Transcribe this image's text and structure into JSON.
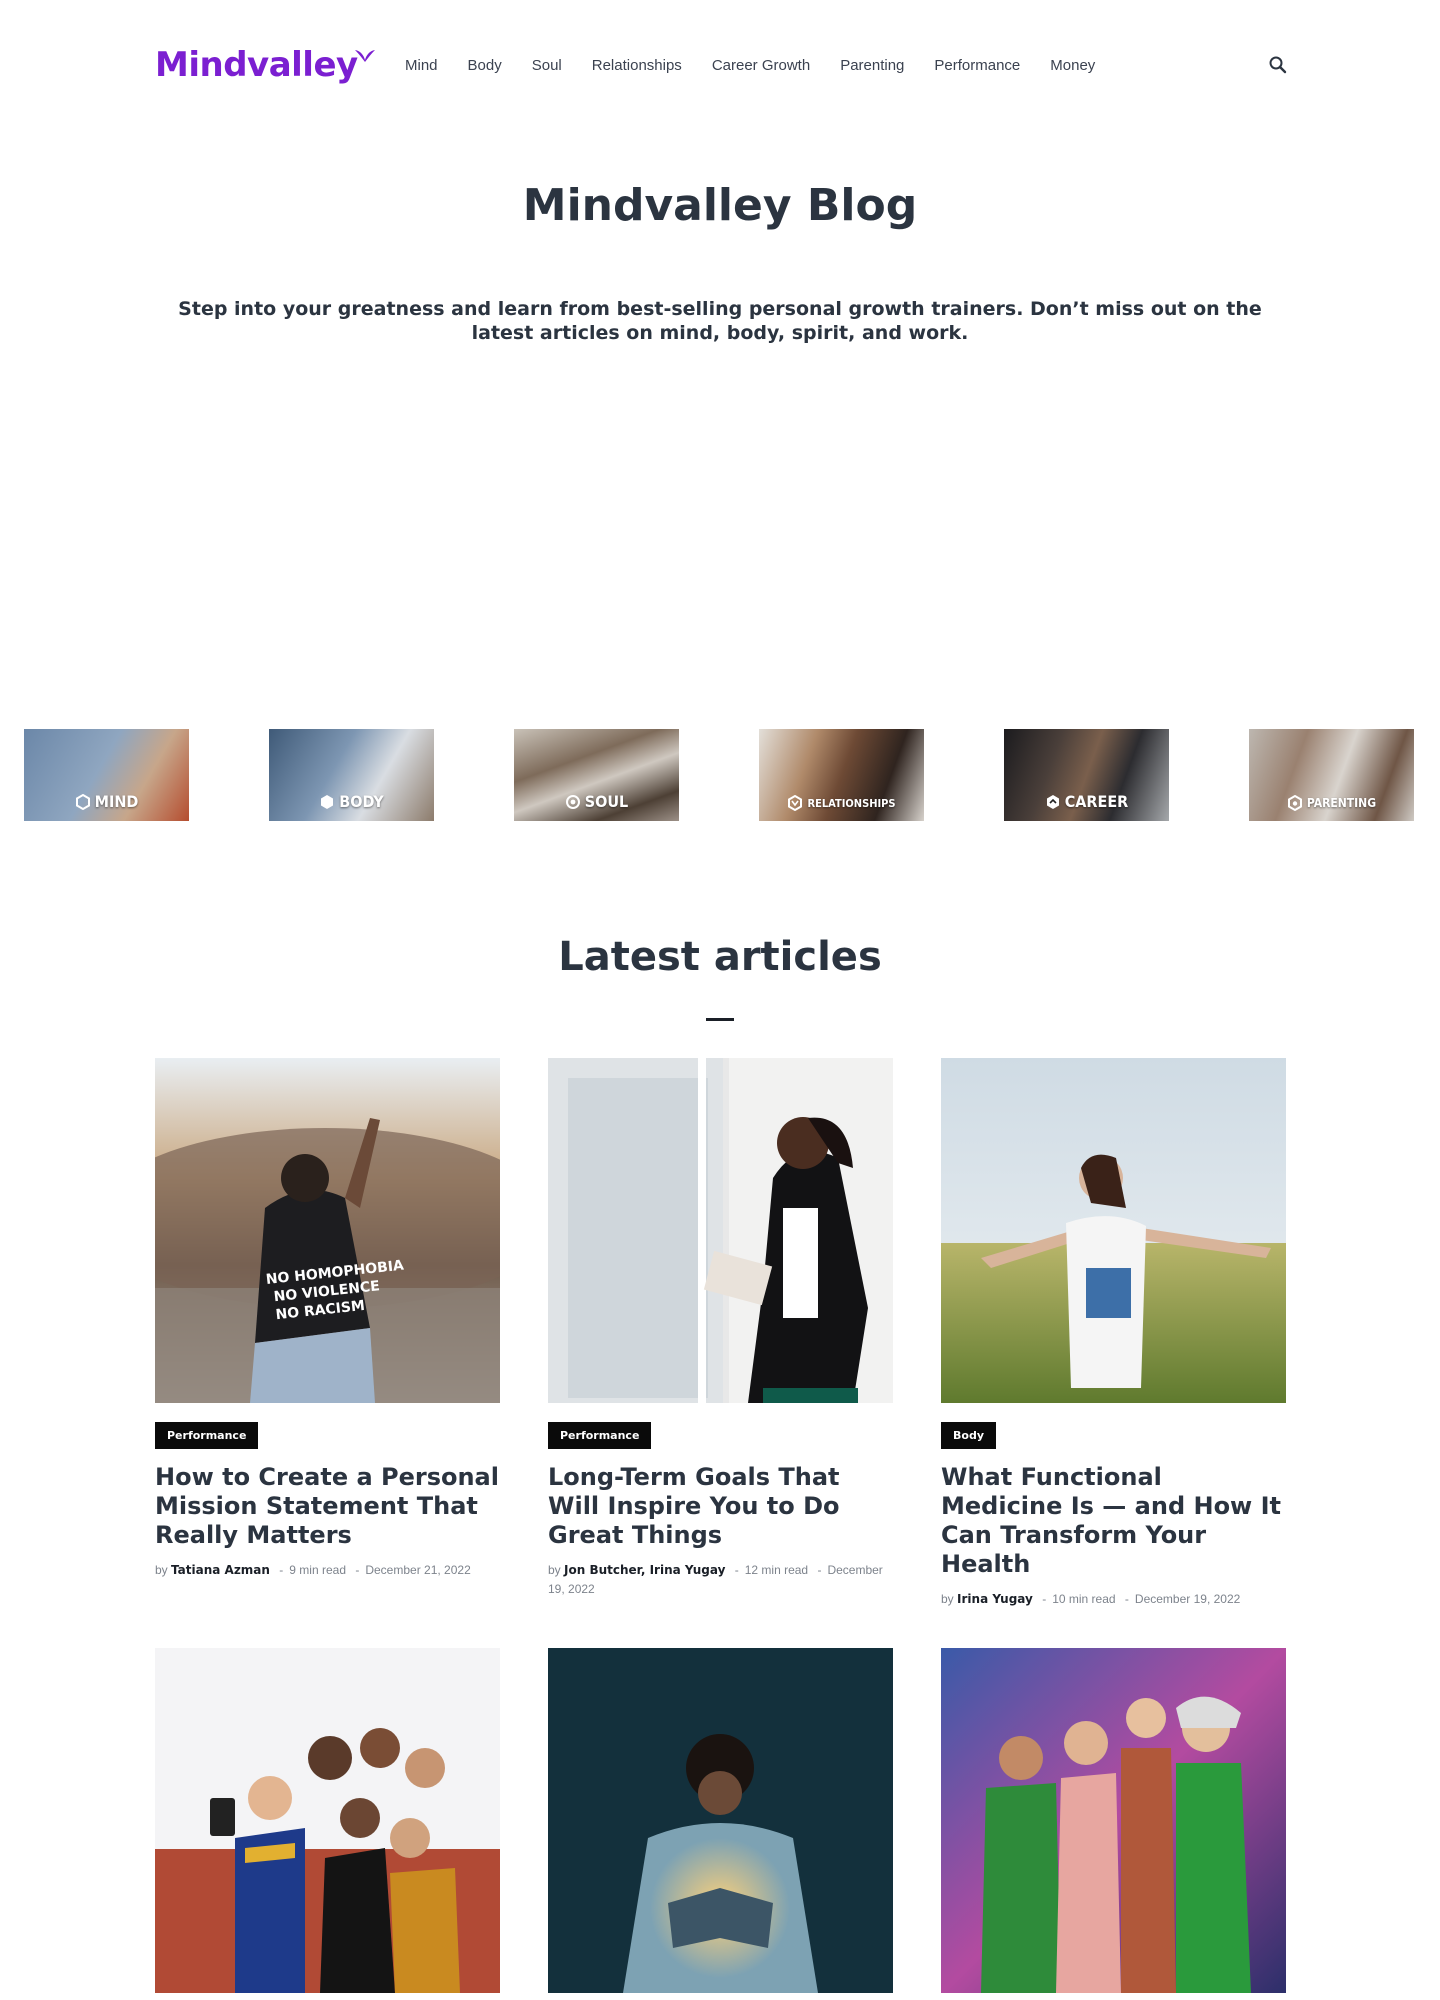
{
  "nav": {
    "logo": "Mindvalley",
    "items": [
      "Mind",
      "Body",
      "Soul",
      "Relationships",
      "Career Growth",
      "Parenting",
      "Performance",
      "Money"
    ],
    "search_icon": "search-icon",
    "brand_color": "#7b1fd1"
  },
  "hero": {
    "title": "Mindvalley Blog",
    "subtitle": "Step into your greatness and learn from best-selling personal growth trainers. Don’t miss out on the latest articles on mind, body, spirit, and work."
  },
  "categories": [
    {
      "label": "MIND",
      "icon": "mind-hex-icon"
    },
    {
      "label": "BODY",
      "icon": "body-hex-icon"
    },
    {
      "label": "SOUL",
      "icon": "soul-circle-icon"
    },
    {
      "label": "RELATIONSHIPS",
      "icon": "relationships-hex-icon"
    },
    {
      "label": "CAREER",
      "icon": "career-hex-icon"
    },
    {
      "label": "PARENTING",
      "icon": "parenting-hex-icon"
    }
  ],
  "latest": {
    "title": "Latest articles",
    "articles": [
      {
        "category": "Performance",
        "title": "How to Create a Personal Mission Statement That Really Matters",
        "by": "by",
        "authors": "Tatiana Azman",
        "read": "9 min read",
        "date": "December 21, 2022",
        "image": "woman-with-shirt-at-bean-photo"
      },
      {
        "category": "Performance",
        "title": "Long-Term Goals That Will Inspire You to Do Great Things",
        "by": "by",
        "authors": "Jon Butcher, Irina Yugay",
        "read": "12 min read",
        "date": "December 19, 2022",
        "image": "woman-at-window-with-notebook-photo"
      },
      {
        "category": "Body",
        "title": "What Functional Medicine Is — and How It Can Transform Your Health",
        "by": "by",
        "authors": "Irina Yugay",
        "read": "10 min read",
        "date": "December 19, 2022",
        "image": "woman-in-field-photo"
      },
      {
        "image": "friends-selfie-photo"
      },
      {
        "image": "man-reading-glowing-book-photo"
      },
      {
        "image": "friends-at-party-photo"
      }
    ]
  }
}
